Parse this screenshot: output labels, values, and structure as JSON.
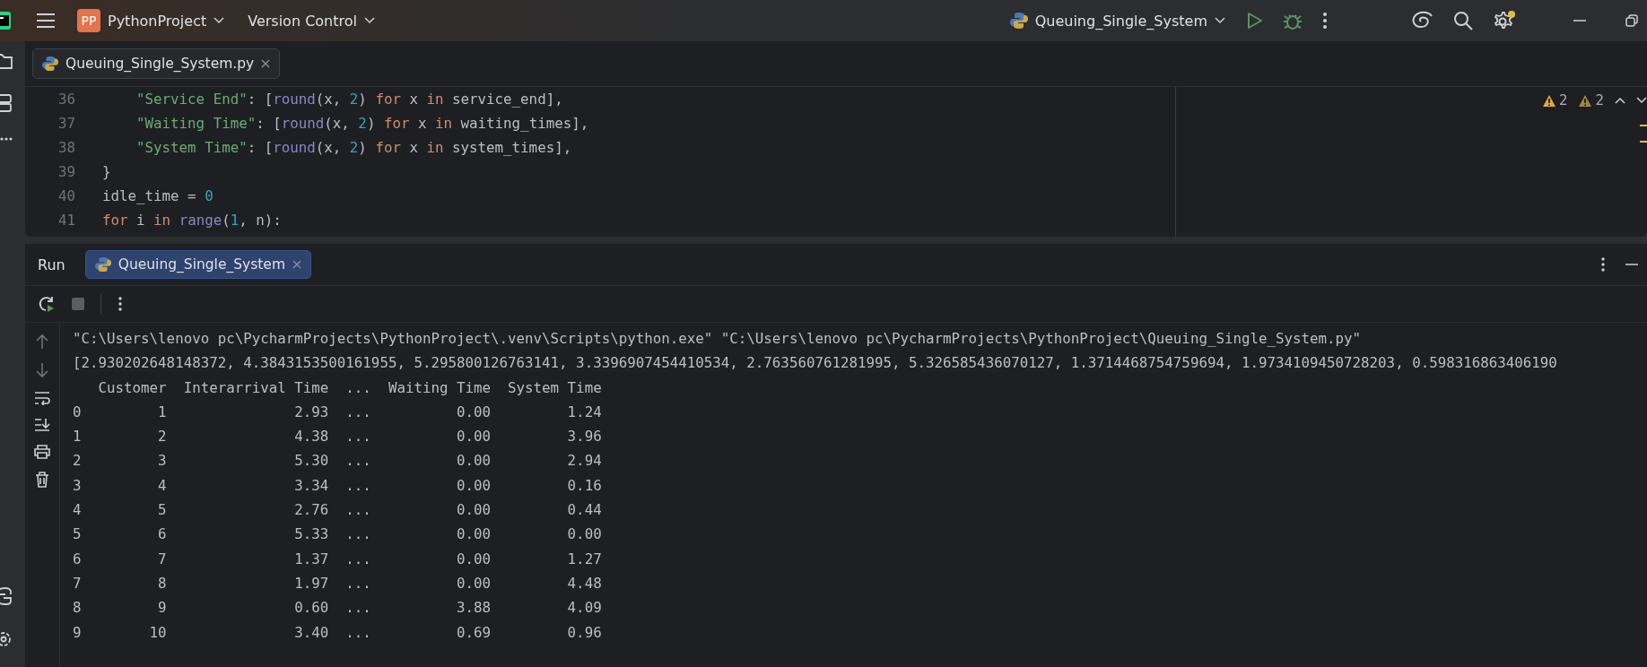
{
  "title_bar": {
    "project_badge": "PP",
    "project": "PythonProject",
    "vcs": "Version Control",
    "run_config": "Queuing_Single_System",
    "settings_notification": true
  },
  "editor": {
    "tabs": [
      {
        "label": "Queuing_Single_System.py",
        "selected": true
      }
    ],
    "inspections": [
      {
        "kind": "warning",
        "count": "2"
      },
      {
        "kind": "weak-warning",
        "count": "2"
      }
    ],
    "lines": [
      {
        "number": "36",
        "tokens": [
          {
            "kind": "string",
            "text": "    \"Service End\""
          },
          {
            "kind": "plain",
            "text": ": ["
          },
          {
            "kind": "builtin",
            "text": "round"
          },
          {
            "kind": "plain",
            "text": "(x, "
          },
          {
            "kind": "number",
            "text": "2"
          },
          {
            "kind": "plain",
            "text": ") "
          },
          {
            "kind": "keyword",
            "text": "for"
          },
          {
            "kind": "plain",
            "text": " x "
          },
          {
            "kind": "keyword",
            "text": "in"
          },
          {
            "kind": "plain",
            "text": " service_end],"
          }
        ]
      },
      {
        "number": "37",
        "tokens": [
          {
            "kind": "string",
            "text": "    \"Waiting Time\""
          },
          {
            "kind": "plain",
            "text": ": ["
          },
          {
            "kind": "builtin",
            "text": "round"
          },
          {
            "kind": "plain",
            "text": "(x, "
          },
          {
            "kind": "number",
            "text": "2"
          },
          {
            "kind": "plain",
            "text": ") "
          },
          {
            "kind": "keyword",
            "text": "for"
          },
          {
            "kind": "plain",
            "text": " x "
          },
          {
            "kind": "keyword",
            "text": "in"
          },
          {
            "kind": "plain",
            "text": " waiting_times],"
          }
        ]
      },
      {
        "number": "38",
        "tokens": [
          {
            "kind": "string",
            "text": "    \"System Time\""
          },
          {
            "kind": "plain",
            "text": ": ["
          },
          {
            "kind": "builtin",
            "text": "round"
          },
          {
            "kind": "plain",
            "text": "(x, "
          },
          {
            "kind": "number",
            "text": "2"
          },
          {
            "kind": "plain",
            "text": ") "
          },
          {
            "kind": "keyword",
            "text": "for"
          },
          {
            "kind": "plain",
            "text": " x "
          },
          {
            "kind": "keyword",
            "text": "in"
          },
          {
            "kind": "plain",
            "text": " system_times],"
          }
        ]
      },
      {
        "number": "39",
        "tokens": [
          {
            "kind": "plain",
            "text": "}"
          }
        ]
      },
      {
        "number": "40",
        "tokens": [
          {
            "kind": "plain",
            "text": "idle_time = "
          },
          {
            "kind": "number",
            "text": "0"
          }
        ]
      },
      {
        "number": "41",
        "tokens": [
          {
            "kind": "keyword",
            "text": "for"
          },
          {
            "kind": "plain",
            "text": " i "
          },
          {
            "kind": "keyword",
            "text": "in "
          },
          {
            "kind": "builtin",
            "text": "range"
          },
          {
            "kind": "plain",
            "text": "("
          },
          {
            "kind": "number",
            "text": "1"
          },
          {
            "kind": "plain",
            "text": ", n):"
          }
        ]
      }
    ]
  },
  "run_panel": {
    "title": "Run",
    "tabs": [
      {
        "label": "Queuing_Single_System",
        "selected": true
      }
    ],
    "output": [
      "\"C:\\Users\\lenovo pc\\PycharmProjects\\PythonProject\\.venv\\Scripts\\python.exe\" \"C:\\Users\\lenovo pc\\PycharmProjects\\PythonProject\\Queuing_Single_System.py\"",
      "[2.930202648148372, 4.3843153500161955, 5.295800126763141, 3.3396907454410534, 2.763560761281995, 5.326585436070127, 1.3714468754759694, 1.9734109450728203, 0.598316863406190",
      "   Customer  Interarrival Time  ...  Waiting Time  System Time",
      "0         1               2.93  ...          0.00         1.24",
      "1         2               4.38  ...          0.00         3.96",
      "2         3               5.30  ...          0.00         2.94",
      "3         4               3.34  ...          0.00         0.16",
      "4         5               2.76  ...          0.00         0.44",
      "5         6               5.33  ...          0.00         0.00",
      "6         7               1.37  ...          0.00         1.27",
      "7         8               1.97  ...          0.00         4.48",
      "8         9               0.60  ...          3.88         4.09",
      "9        10               3.40  ...          0.69         0.96"
    ]
  }
}
